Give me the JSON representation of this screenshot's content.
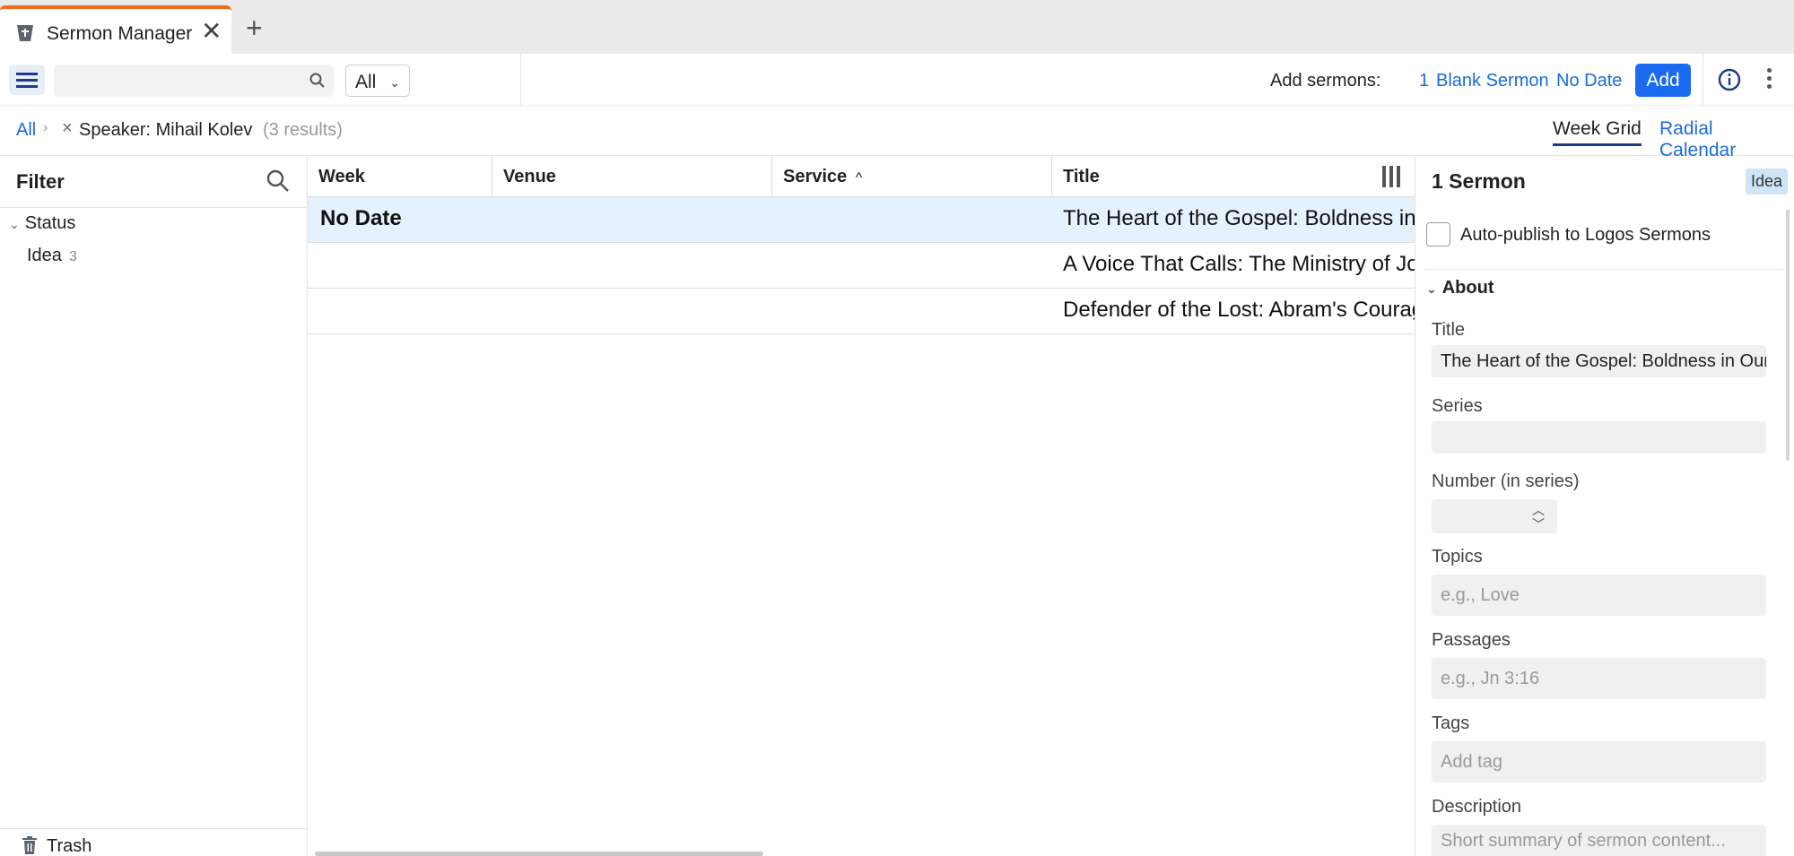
{
  "tab": {
    "title": "Sermon Manager",
    "close": "✕",
    "add": "+"
  },
  "toolbar": {
    "search_placeholder": "",
    "filter_value": "All",
    "add_label": "Add sermons:",
    "add_count": "1",
    "add_blank": "Blank Sermon",
    "add_nodate": "No Date",
    "add_button": "Add"
  },
  "breadcrumb": {
    "all": "All",
    "sep": "›",
    "remove": "×",
    "speaker": "Speaker: Mihail Kolev",
    "count": "(3 results)"
  },
  "views": {
    "week_grid": "Week Grid",
    "radial_calendar": "Radial Calendar",
    "active": "Week Grid"
  },
  "filter": {
    "title": "Filter",
    "status_label": "Status",
    "items": [
      {
        "label": "Idea",
        "count": "3"
      }
    ],
    "trash": "Trash"
  },
  "grid": {
    "columns": [
      "Week",
      "Venue",
      "Service",
      "Title"
    ],
    "sort_column": "Service",
    "sort_indicator": "^",
    "rows": [
      {
        "week": "No Date",
        "title": "The Heart of the Gospel: Boldness in Our Faith",
        "selected": true
      },
      {
        "week": "",
        "title": "A Voice That Calls: The Ministry of John the Baptist",
        "selected": false
      },
      {
        "week": "",
        "title": "Defender of the Lost: Abram's Courage",
        "selected": false
      }
    ]
  },
  "detail": {
    "title": "1 Sermon",
    "badge": "Idea",
    "autopublish_label": "Auto-publish to Logos Sermons",
    "about_label": "About",
    "fields": {
      "title_label": "Title",
      "title_value": "The Heart of the Gospel: Boldness in Our Faith",
      "series_label": "Series",
      "series_value": "",
      "number_label": "Number (in series)",
      "topics_label": "Topics",
      "topics_placeholder": "e.g., Love",
      "passages_label": "Passages",
      "passages_placeholder": "e.g., Jn 3:16",
      "tags_label": "Tags",
      "tags_placeholder": "Add tag",
      "description_label": "Description",
      "description_placeholder": "Short summary of sermon content..."
    }
  },
  "colors": {
    "accent": "#1a6bf0",
    "link": "#1a6bdc",
    "tab_highlight": "#f26a1b",
    "selected_row": "#e5f1fc",
    "nav": "#1d3a8a"
  },
  "icons": {
    "tab": "podium-icon",
    "menu": "hamburger-icon",
    "search": "search-icon",
    "info": "info-icon",
    "more": "more-vertical-icon",
    "trash": "trash-icon",
    "columns": "column-chooser-icon"
  }
}
